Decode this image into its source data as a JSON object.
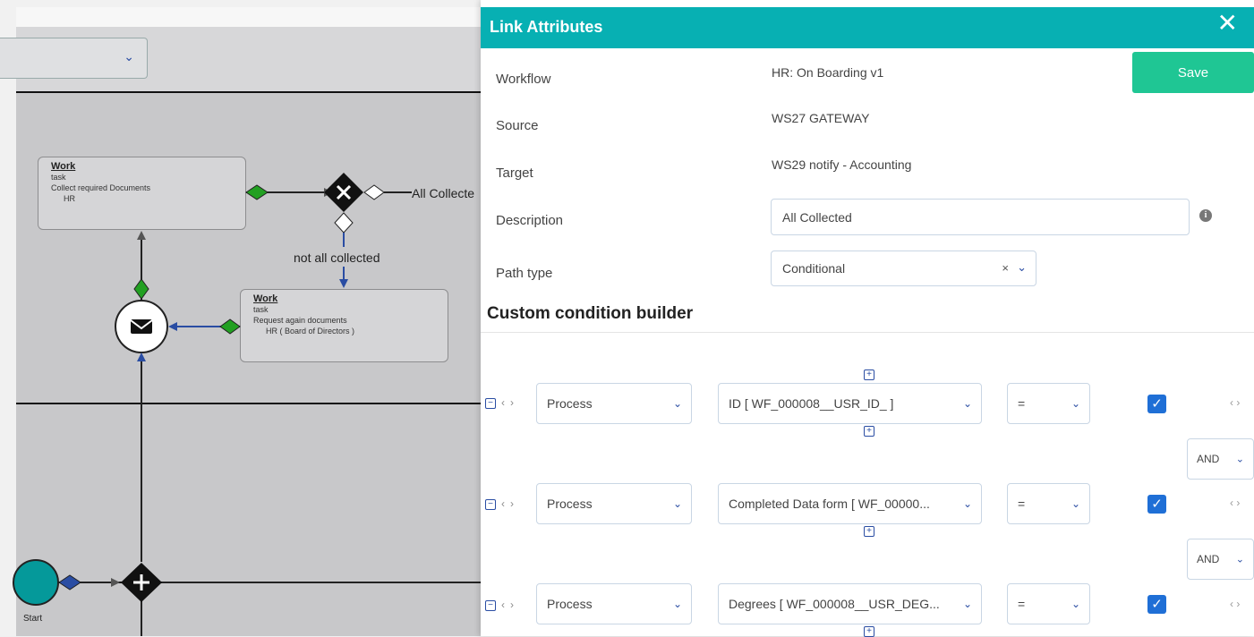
{
  "modal": {
    "title": "Link Attributes",
    "close_glyph": "✕",
    "save_label": "Save",
    "fields": {
      "workflow_label": "Workflow",
      "workflow_value": "HR: On Boarding v1",
      "source_label": "Source",
      "source_value": "WS27 GATEWAY",
      "target_label": "Target",
      "target_value": "WS29 notify - Accounting",
      "description_label": "Description",
      "description_value": "All Collected",
      "path_type_label": "Path type",
      "path_type_value": "Conditional",
      "clear_glyph": "×"
    },
    "builder_title": "Custom condition builder",
    "conditions": [
      {
        "scope": "Process",
        "field": "ID [ WF_000008__USR_ID_ ]",
        "operator": "=",
        "checked": true
      },
      {
        "scope": "Process",
        "field": "Completed Data form [ WF_00000...",
        "operator": "=",
        "checked": true
      },
      {
        "scope": "Process",
        "field": "Degrees [ WF_000008__USR_DEG...",
        "operator": "=",
        "checked": true
      }
    ],
    "connectors": [
      "AND",
      "AND"
    ],
    "glyphs": {
      "chevron": "⌄",
      "minus": "−",
      "plus": "+",
      "left": "‹",
      "right": "›",
      "check": "✓",
      "info": "i"
    }
  },
  "diagram": {
    "task1": {
      "title": "Work",
      "type": "task",
      "name": "Collect required Documents",
      "role": "HR"
    },
    "task2": {
      "title": "Work",
      "type": "task",
      "name": "Request again documents",
      "role": "HR ( Board of Directors )"
    },
    "edge_all_collected": "All Collecte",
    "edge_not_all_collected": "not all collected",
    "start_label": "Start"
  },
  "colors": {
    "accent_header": "#07b0b3",
    "save_button": "#1fc694",
    "checkbox": "#1f6fd6",
    "gateway_diamond": "#22a022"
  }
}
